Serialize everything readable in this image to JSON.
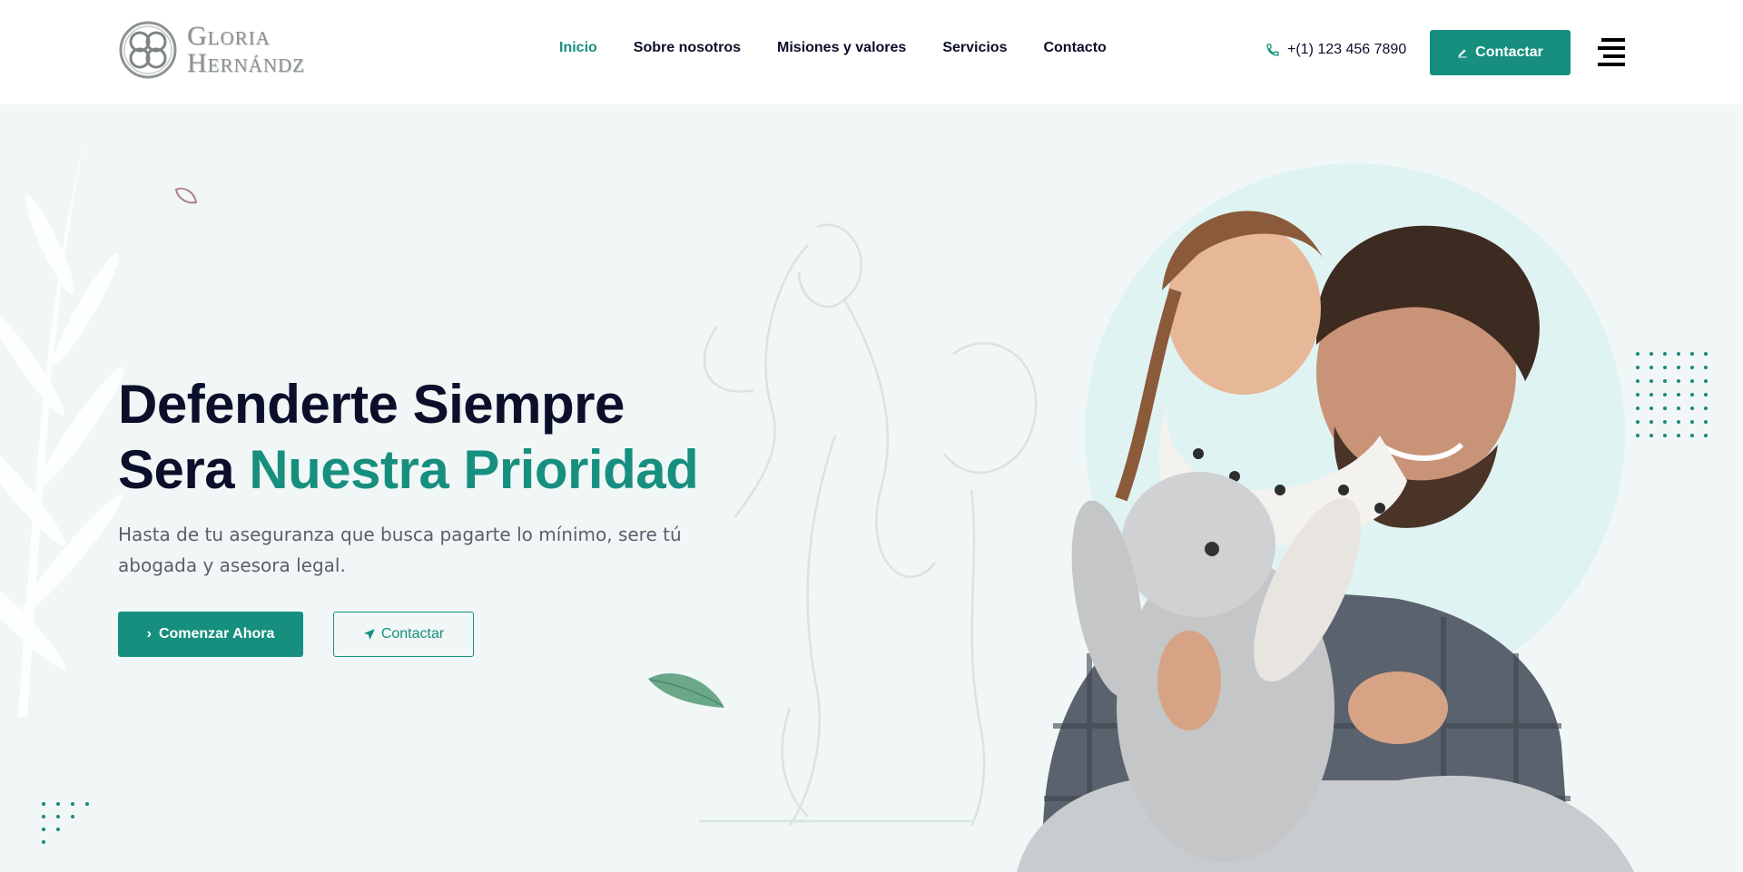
{
  "header": {
    "logo": {
      "line1": "Gloria",
      "line2": "Hernándz"
    },
    "nav": [
      {
        "label": "Inicio",
        "active": true
      },
      {
        "label": "Sobre nosotros",
        "active": false
      },
      {
        "label": "Misiones y valores",
        "active": false
      },
      {
        "label": "Servicios",
        "active": false
      },
      {
        "label": "Contacto",
        "active": false
      }
    ],
    "phone": "+(1) 123 456 7890",
    "cta_label": "Contactar"
  },
  "hero": {
    "title_line1": "Defenderte Siempre",
    "title_line2_plain": "Sera ",
    "title_line2_accent": "Nuestra Prioridad",
    "subtitle": "Hasta de tu aseguranza que busca pagarte lo mínimo, sere tú abogada y asesora legal.",
    "primary_button": "Comenzar Ahora",
    "secondary_button": "Contactar"
  },
  "colors": {
    "accent": "#178f7f",
    "dark": "#0b0f2a",
    "hero_bg": "#f0f7f6",
    "text_muted": "#5a5f6e"
  },
  "icons": {
    "phone": "phone-icon",
    "pen": "pen-icon",
    "menu": "hamburger-menu-icon",
    "chevron": "chevron-right-icon",
    "send": "paper-plane-icon"
  }
}
